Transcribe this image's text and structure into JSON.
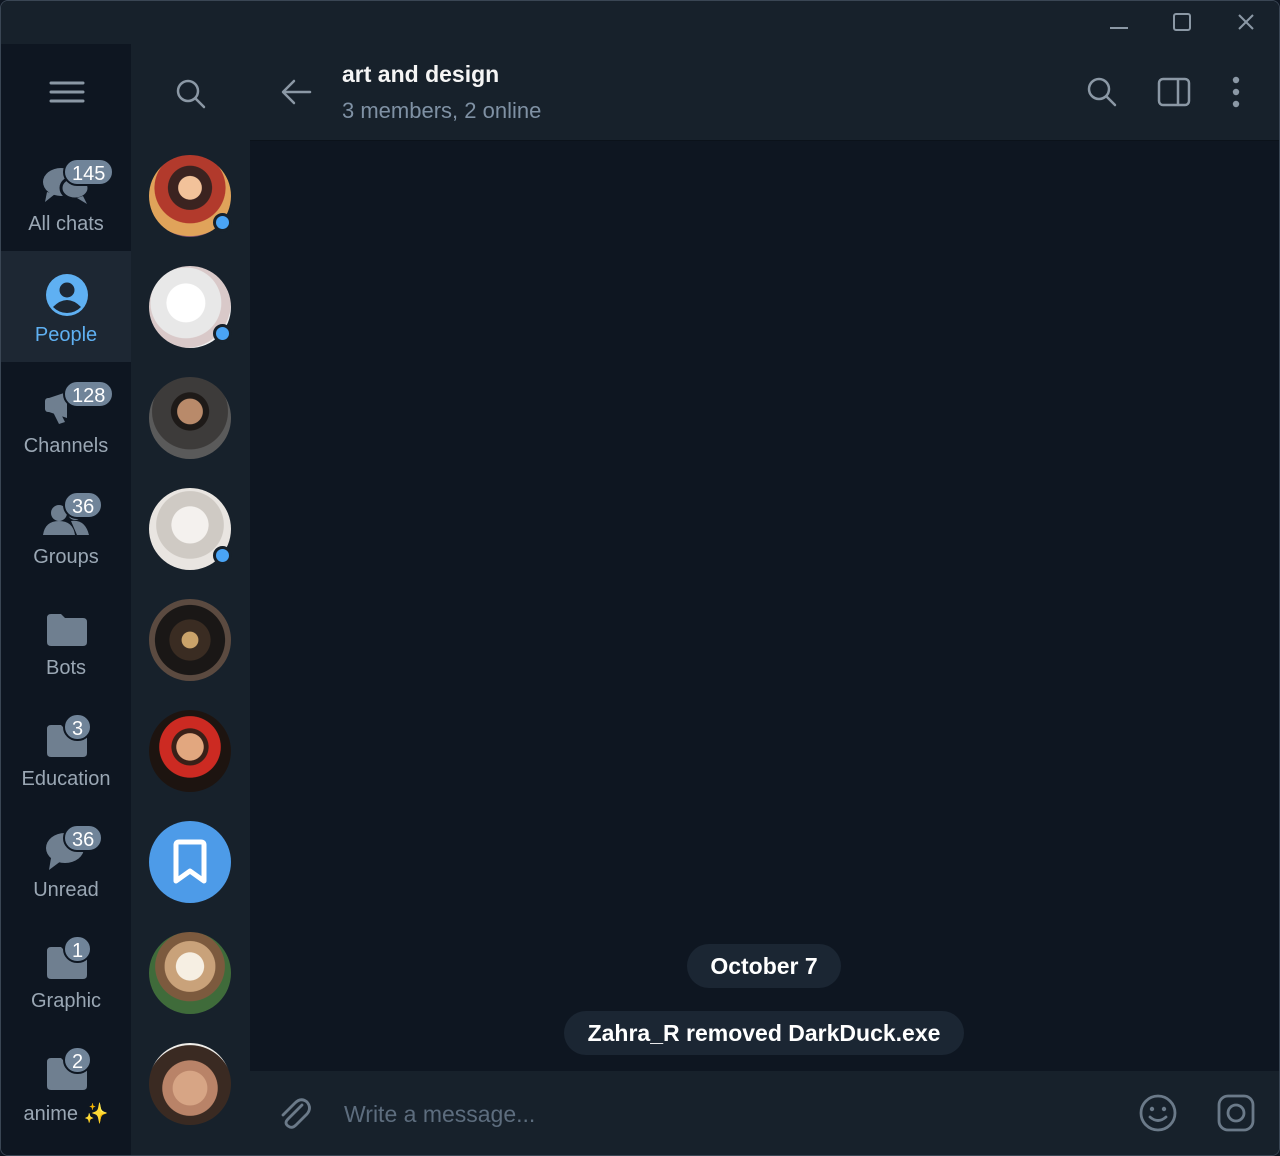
{
  "window_controls": [
    "minimize-icon",
    "maximize-icon",
    "close-icon"
  ],
  "rail": {
    "menu_icon": "hamburger-menu-icon",
    "folders": [
      {
        "label": "All chats",
        "badge": "145",
        "icon": "chats-icon"
      },
      {
        "label": "People",
        "badge": "",
        "icon": "person-icon",
        "active": true
      },
      {
        "label": "Channels",
        "badge": "128",
        "icon": "megaphone-icon"
      },
      {
        "label": "Groups",
        "badge": "36",
        "icon": "group-icon"
      },
      {
        "label": "Bots",
        "badge": "",
        "icon": "folder-icon"
      },
      {
        "label": "Education",
        "badge": "3",
        "icon": "folder-icon"
      },
      {
        "label": "Unread",
        "badge": "36",
        "icon": "chat-bubble-icon"
      },
      {
        "label": "Graphic",
        "badge": "1",
        "icon": "folder-icon"
      },
      {
        "label": "anime ✨",
        "badge": "2",
        "icon": "folder-icon"
      }
    ]
  },
  "chatlist": {
    "search_icon": "search-icon",
    "avatars": [
      {
        "kind": "photo",
        "online": true
      },
      {
        "kind": "sketch",
        "online": true
      },
      {
        "kind": "photo",
        "online": false
      },
      {
        "kind": "drawing",
        "online": true
      },
      {
        "kind": "photo",
        "online": false
      },
      {
        "kind": "photo",
        "online": false
      },
      {
        "kind": "saved-messages",
        "online": false
      },
      {
        "kind": "owl",
        "online": false
      },
      {
        "kind": "photo",
        "online": false
      }
    ]
  },
  "header": {
    "title": "art and design",
    "subtitle": "3 members, 2 online"
  },
  "messages": {
    "date": "October 7",
    "service": "Zahra_R removed DarkDuck.exe"
  },
  "composer": {
    "placeholder": "Write a message..."
  },
  "colors": {
    "background": "#0e1621",
    "panel": "#17212b",
    "accent": "#5fb0f2",
    "online": "#4aa4f5",
    "badge": "#708499"
  }
}
